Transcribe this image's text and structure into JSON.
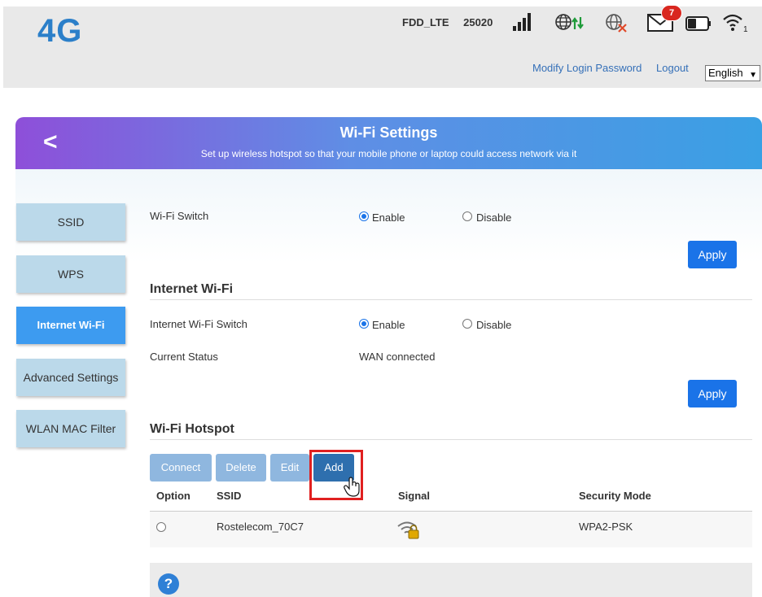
{
  "header": {
    "logo": "4G",
    "network_type": "FDD_LTE",
    "operator_code": "25020",
    "unread_messages": "7",
    "wifi_clients": "1",
    "modify_password_link": "Modify Login Password",
    "logout_link": "Logout",
    "language_selected": "English"
  },
  "banner": {
    "back_symbol": "<",
    "title": "Wi-Fi Settings",
    "subtitle": "Set up wireless hotspot so that your mobile phone or laptop could access network via it"
  },
  "sidebar": {
    "items": [
      {
        "label": "SSID",
        "active": false
      },
      {
        "label": "WPS",
        "active": false
      },
      {
        "label": "Internet Wi-Fi",
        "active": true
      },
      {
        "label": "Advanced Settings",
        "active": false
      },
      {
        "label": "WLAN MAC Filter",
        "active": false
      }
    ]
  },
  "wifi_switch": {
    "label": "Wi-Fi Switch",
    "enable_label": "Enable",
    "disable_label": "Disable",
    "selected": "Enable",
    "apply_label": "Apply"
  },
  "internet_wifi": {
    "section_title": "Internet Wi-Fi",
    "switch_label": "Internet Wi-Fi Switch",
    "enable_label": "Enable",
    "disable_label": "Disable",
    "selected": "Enable",
    "status_label": "Current Status",
    "status_value": "WAN connected",
    "apply_label": "Apply"
  },
  "hotspot": {
    "section_title": "Wi-Fi Hotspot",
    "buttons": {
      "connect": "Connect",
      "delete": "Delete",
      "edit": "Edit",
      "add": "Add"
    },
    "columns": [
      "Option",
      "SSID",
      "Signal",
      "Security Mode"
    ],
    "rows": [
      {
        "ssid": "Rostelecom_70C7",
        "signal_icon": "wifi-lock-icon",
        "security_mode": "WPA2-PSK",
        "selected": false
      }
    ]
  },
  "help": {
    "symbol": "?"
  },
  "colors": {
    "accent": "#1a73e8",
    "logo": "#2b7fc9",
    "sidebar_active": "#3d9bf0",
    "sidebar_inactive": "#bbd9ea",
    "highlight": "#e02020",
    "badge": "#d9271f"
  }
}
